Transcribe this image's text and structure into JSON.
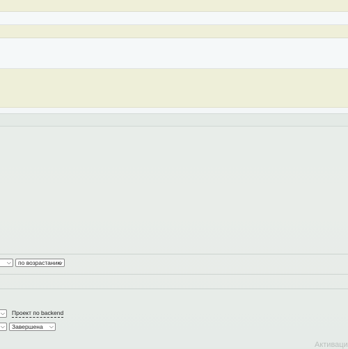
{
  "sort": {
    "order_select": "по возрастанию"
  },
  "filters": {
    "project_link": "Проект по backend",
    "status_select": "Завершена"
  },
  "watermark": "Активаци"
}
